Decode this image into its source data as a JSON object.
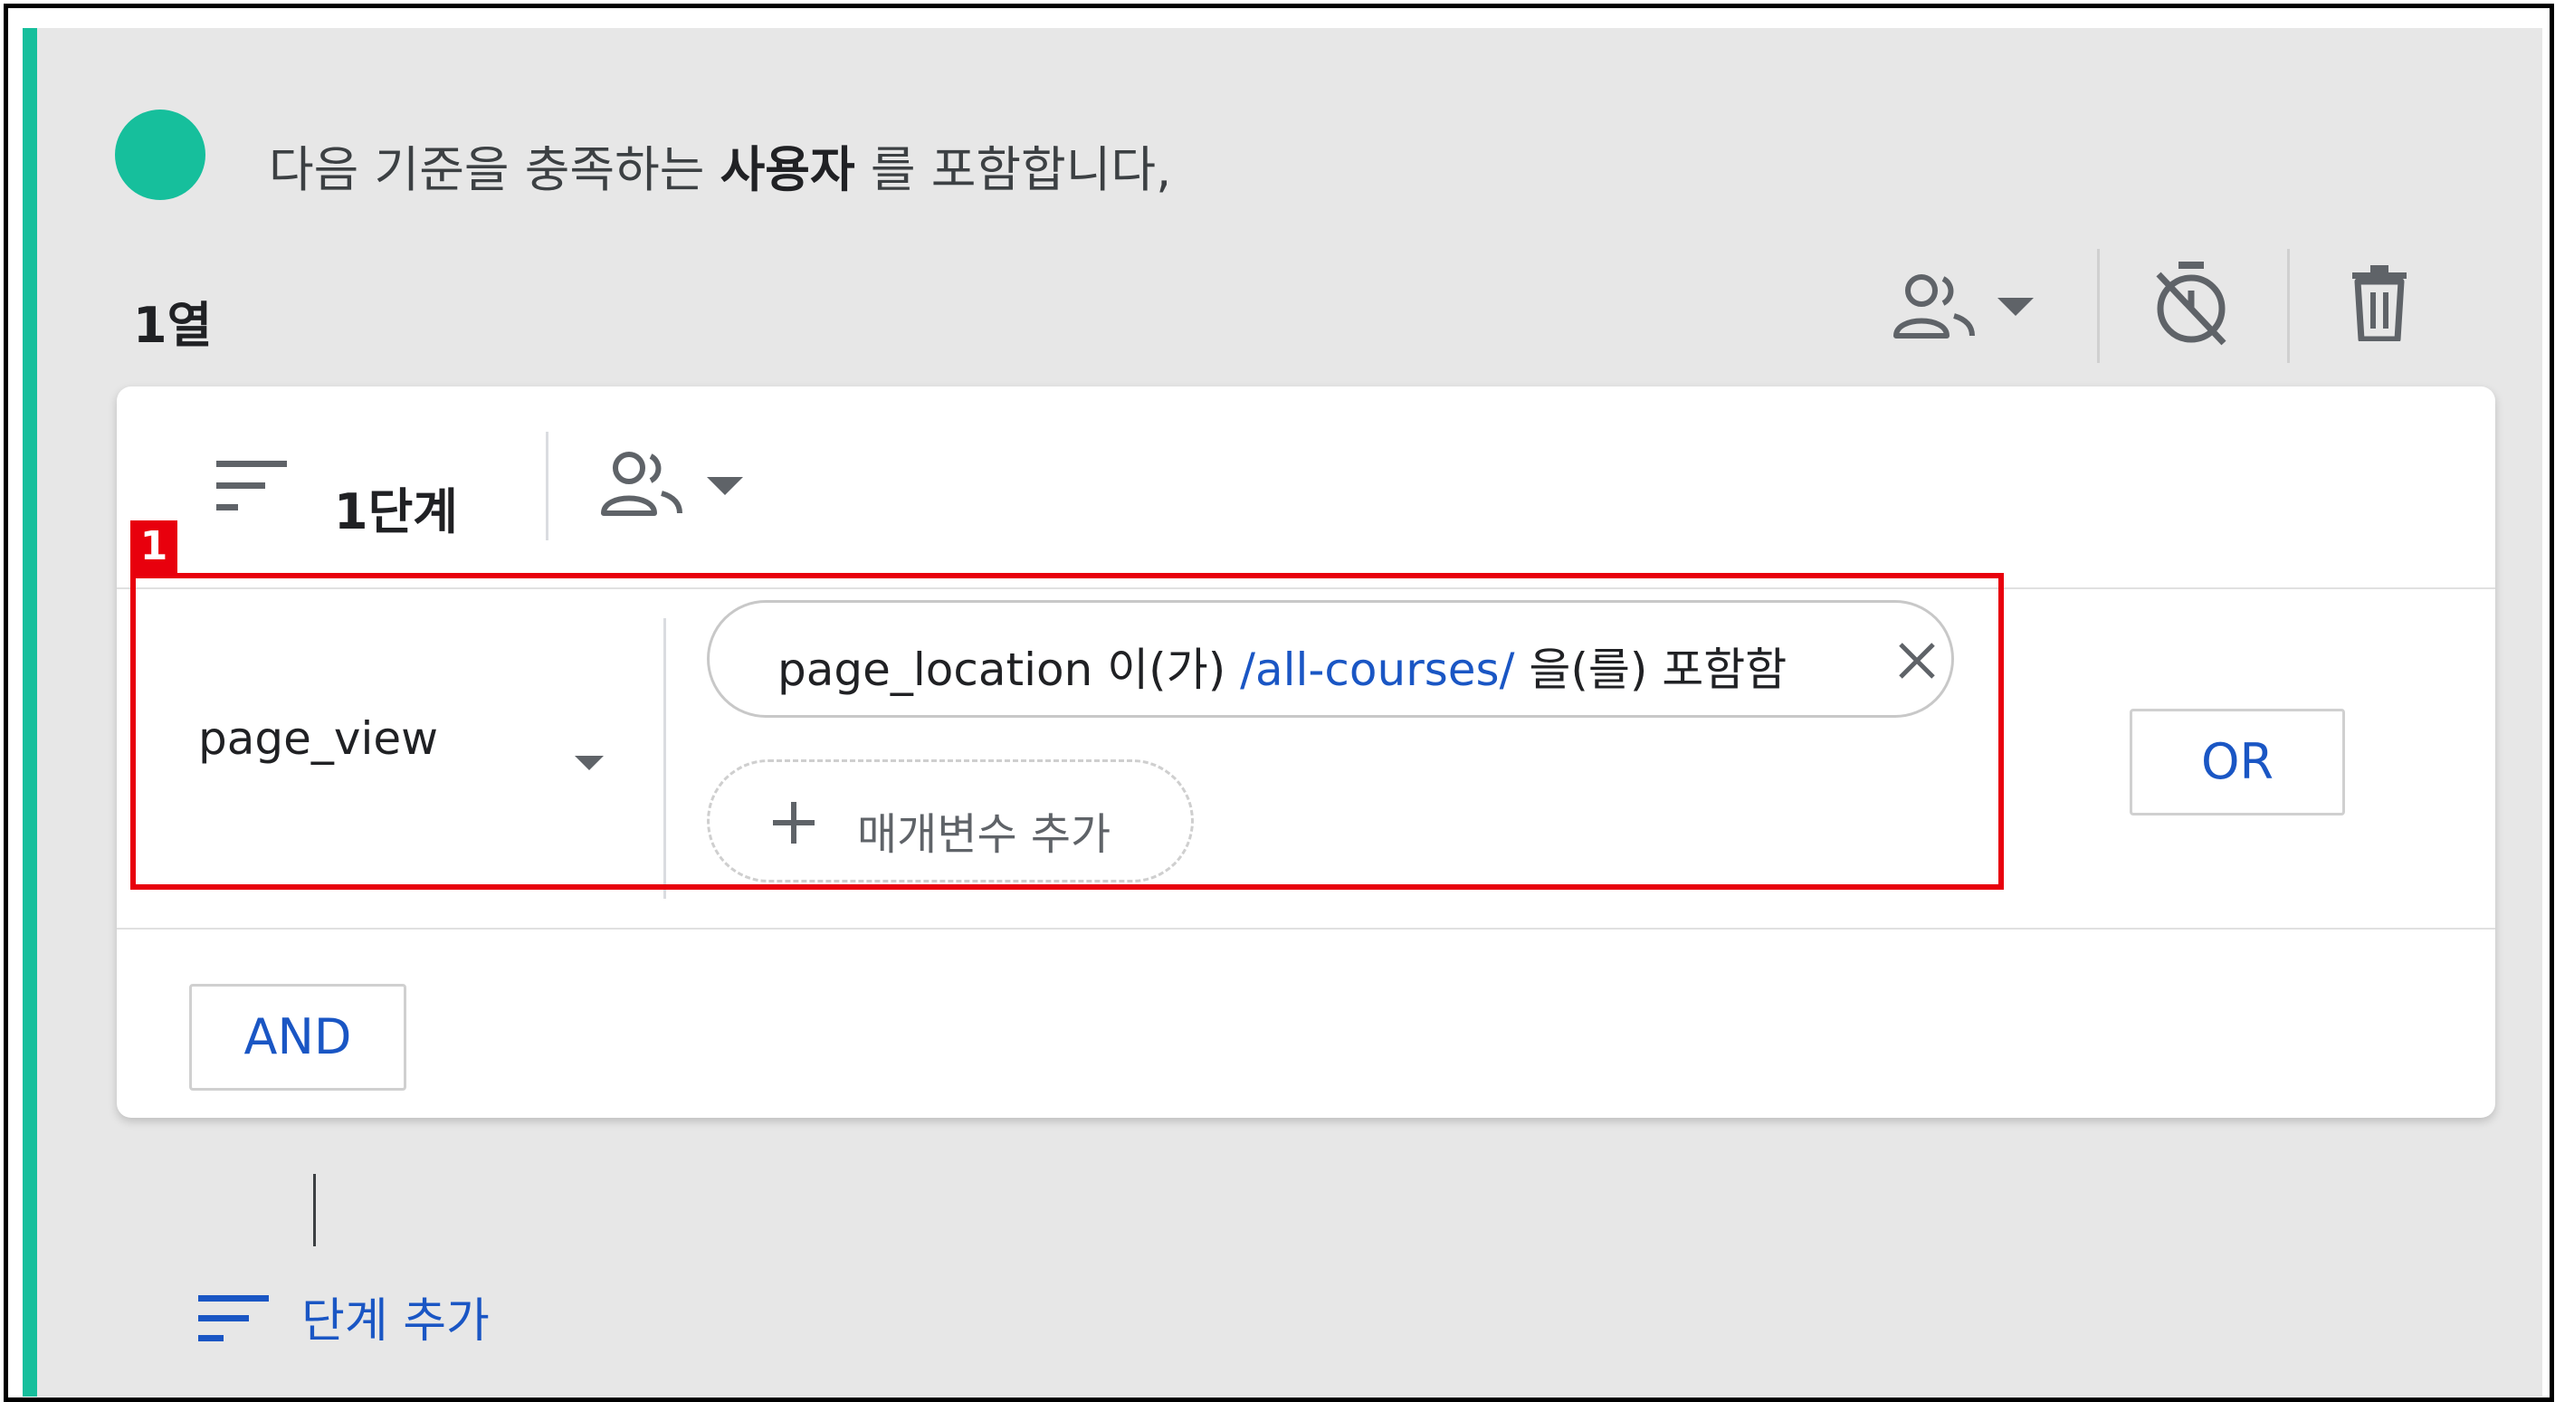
{
  "header": {
    "text_before": "다음 기준을 충족하는",
    "text_bold": "사용자",
    "text_after": "를 포함합니다,"
  },
  "column": {
    "label": "1열",
    "icons": [
      "people-icon",
      "chevron-down-icon",
      "timer-off-icon",
      "trash-icon"
    ]
  },
  "step": {
    "label": "1단계",
    "icons": [
      "filter-list-icon",
      "people-icon",
      "chevron-down-icon"
    ]
  },
  "condition": {
    "event_name": "page_view",
    "chip": {
      "param": "page_location",
      "operator_prefix": "이(가)",
      "value": "/all-courses/",
      "operator_suffix": "을(를) 포함함"
    },
    "add_param_label": "매개변수 추가",
    "or_label": "OR"
  },
  "and_label": "AND",
  "add_step_label": "단계 추가",
  "annotation": {
    "badge": "1"
  },
  "colors": {
    "accent": "#16bf9c",
    "link_blue": "#1a56c4",
    "highlight_red": "#e8000d",
    "panel_bg": "#e7e7e7"
  }
}
